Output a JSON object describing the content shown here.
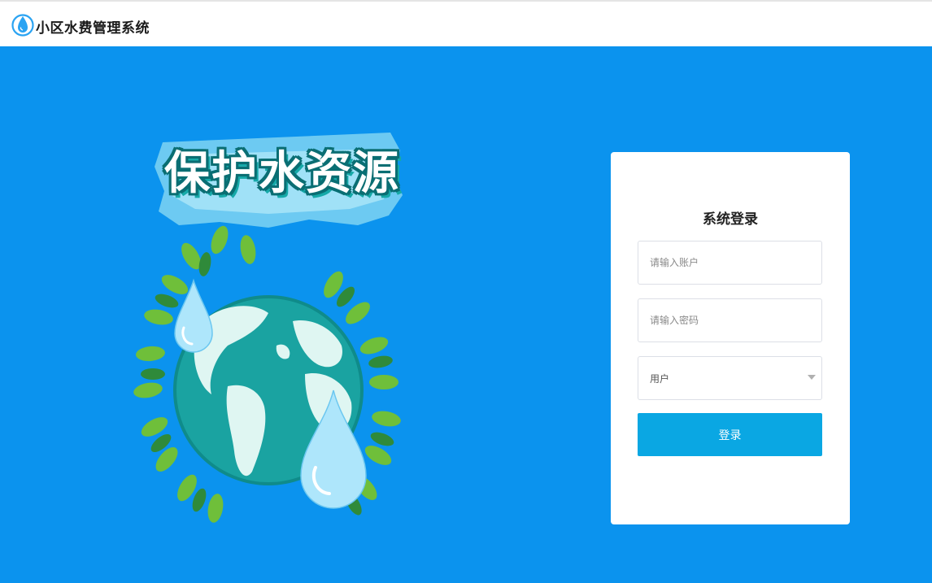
{
  "header": {
    "app_title": "小区水费管理系统",
    "logo_icon": "water-drop-icon"
  },
  "hero": {
    "slogan": "保护水资源",
    "illustration": "earth-globe-with-water-drops-and-leaves"
  },
  "login": {
    "title": "系统登录",
    "account_placeholder": "请输入账户",
    "password_placeholder": "请输入密码",
    "role_value": "用户",
    "submit_label": "登录"
  },
  "colors": {
    "background": "#0b93ee",
    "button": "#0aa7e3",
    "card": "#ffffff"
  }
}
